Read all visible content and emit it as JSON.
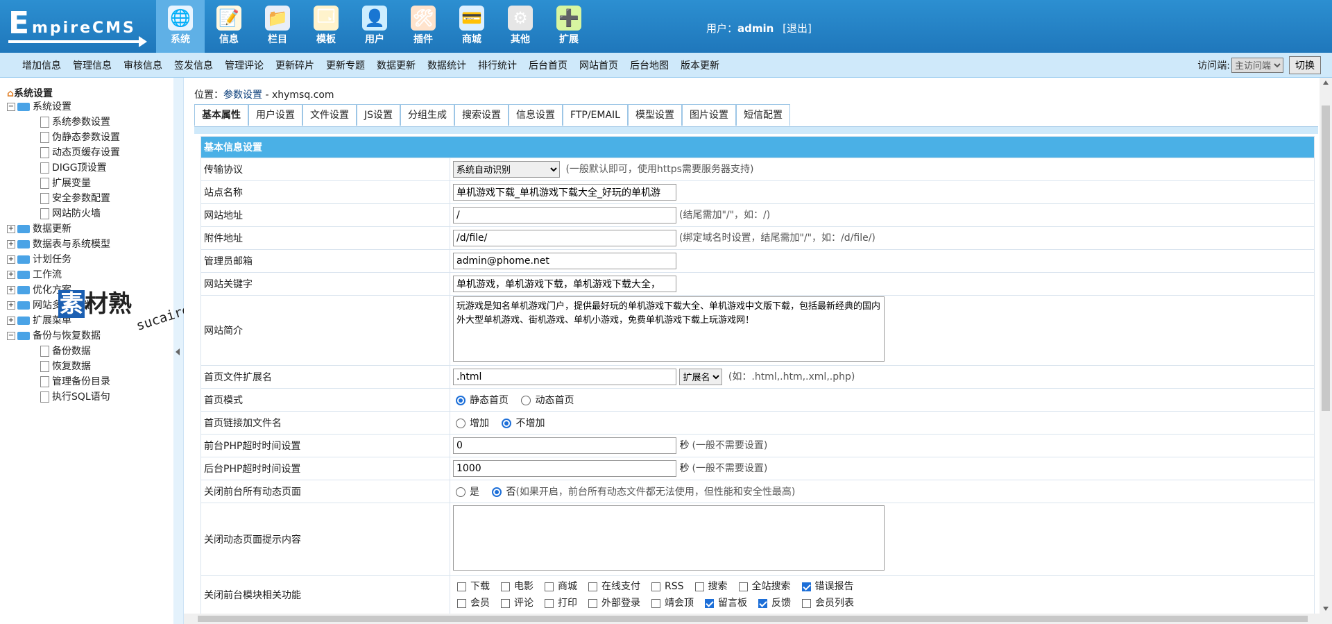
{
  "header": {
    "logo_text": "EmpireCMS",
    "logo_big": "E",
    "logo_rest": "mpireCMS",
    "nav": [
      {
        "label": "系统",
        "icon": "globe-icon",
        "glyph": "🌐",
        "color": "#e8f4ff",
        "active": true
      },
      {
        "label": "信息",
        "icon": "notepad-icon",
        "glyph": "📝",
        "color": "#fff8e0",
        "active": false
      },
      {
        "label": "栏目",
        "icon": "folder-icon",
        "glyph": "📁",
        "color": "#e8eef8",
        "active": false
      },
      {
        "label": "模板",
        "icon": "window-icon",
        "glyph": "🗔",
        "color": "#fff3cc",
        "active": false
      },
      {
        "label": "用户",
        "icon": "user-icon",
        "glyph": "👤",
        "color": "#cdeeff",
        "active": false
      },
      {
        "label": "插件",
        "icon": "tools-icon",
        "glyph": "🛠",
        "color": "#ffe3cc",
        "active": false
      },
      {
        "label": "商城",
        "icon": "card-icon",
        "glyph": "💳",
        "color": "#ddf0ff",
        "active": false
      },
      {
        "label": "其他",
        "icon": "gear-icon",
        "glyph": "⚙",
        "color": "#e6e6e6",
        "active": false
      },
      {
        "label": "扩展",
        "icon": "plus-circle-icon",
        "glyph": "➕",
        "color": "#d7f5a0",
        "active": false
      }
    ],
    "user_label": "用户：",
    "username": "admin",
    "logout": "[退出]"
  },
  "subnav": {
    "items": [
      "增加信息",
      "管理信息",
      "审核信息",
      "签发信息",
      "管理评论",
      "更新碎片",
      "更新专题",
      "数据更新",
      "数据统计",
      "排行统计",
      "后台首页",
      "网站首页",
      "后台地图",
      "版本更新"
    ],
    "visit_label": "访问端:",
    "visit_value": "主访问端",
    "switch_label": "切换"
  },
  "sidebar": {
    "root": "系统设置",
    "rows": [
      {
        "label": "系统设置",
        "type": "folder",
        "toggle": "−",
        "indent": 0
      },
      {
        "label": "系统参数设置",
        "type": "doc",
        "indent": 1
      },
      {
        "label": "伪静态参数设置",
        "type": "doc",
        "indent": 1
      },
      {
        "label": "动态页缓存设置",
        "type": "doc",
        "indent": 1
      },
      {
        "label": "DIGG顶设置",
        "type": "doc",
        "indent": 1
      },
      {
        "label": "扩展变量",
        "type": "doc",
        "indent": 1
      },
      {
        "label": "安全参数配置",
        "type": "doc",
        "indent": 1
      },
      {
        "label": "网站防火墙",
        "type": "doc",
        "indent": 1
      },
      {
        "label": "数据更新",
        "type": "folder",
        "toggle": "+",
        "indent": 0
      },
      {
        "label": "数据表与系统模型",
        "type": "folder",
        "toggle": "+",
        "indent": 0
      },
      {
        "label": "计划任务",
        "type": "folder",
        "toggle": "+",
        "indent": 0
      },
      {
        "label": "工作流",
        "type": "folder",
        "toggle": "+",
        "indent": 0
      },
      {
        "label": "优化方案",
        "type": "folder",
        "toggle": "+",
        "indent": 0
      },
      {
        "label": "网站多访问端",
        "type": "folder",
        "toggle": "+",
        "indent": 0
      },
      {
        "label": "扩展菜单",
        "type": "folder",
        "toggle": "+",
        "indent": 0
      },
      {
        "label": "备份与恢复数据",
        "type": "folder",
        "toggle": "−",
        "indent": 0
      },
      {
        "label": "备份数据",
        "type": "doc",
        "indent": 1
      },
      {
        "label": "恢复数据",
        "type": "doc",
        "indent": 1
      },
      {
        "label": "管理备份目录",
        "type": "doc",
        "indent": 1
      },
      {
        "label": "执行SQL语句",
        "type": "doc",
        "indent": 1
      }
    ]
  },
  "watermark": {
    "brand": "素",
    "brand_rest": "材熟",
    "url": "sucaire.com"
  },
  "content": {
    "breadcrumb_prefix": "位置：",
    "breadcrumb_link": "参数设置",
    "breadcrumb_suffix": " - xhymsq.com",
    "tabs": [
      "基本属性",
      "用户设置",
      "文件设置",
      "JS设置",
      "分组生成",
      "搜索设置",
      "信息设置",
      "FTP/EMAIL",
      "模型设置",
      "图片设置",
      "短信配置"
    ],
    "active_tab": 0,
    "section_title": "基本信息设置",
    "rows": {
      "protocol": {
        "label": "传输协议",
        "value": "系统自动识别",
        "note": "(一般默认即可，使用https需要服务器支持)"
      },
      "sitename": {
        "label": "站点名称",
        "value": "单机游戏下载_单机游戏下载大全_好玩的单机游"
      },
      "siteurl": {
        "label": "网站地址",
        "value": "/",
        "note": "(结尾需加\"/\"，如：/)"
      },
      "fileurl": {
        "label": "附件地址",
        "value": "/d/file/",
        "note": "(绑定域名时设置，结尾需加\"/\"，如：/d/file/)"
      },
      "email": {
        "label": "管理员邮箱",
        "value": "admin@phome.net"
      },
      "keywords": {
        "label": "网站关键字",
        "value": "单机游戏，单机游戏下载，单机游戏下载大全，"
      },
      "intro": {
        "label": "网站简介",
        "value": "玩游戏是知名单机游戏门户，提供最好玩的单机游戏下载大全、单机游戏中文版下载，包括最新经典的国内外大型单机游戏、街机游戏、单机小游戏，免费单机游戏下载上玩游戏网！"
      },
      "indexext": {
        "label": "首页文件扩展名",
        "value": ".html",
        "select": "扩展名",
        "note": "(如：.html,.htm,.xml,.php)"
      },
      "indexmode": {
        "label": "首页模式",
        "opt1": "静态首页",
        "opt2": "动态首页"
      },
      "indexlink": {
        "label": "首页链接加文件名",
        "opt1": "增加",
        "opt2": "不增加"
      },
      "phptimeout": {
        "label": "前台PHP超时时间设置",
        "value": "0",
        "unit": "秒",
        "note": "(一般不需要设置)"
      },
      "adminphptimeout": {
        "label": "后台PHP超时时间设置",
        "value": "1000",
        "unit": "秒",
        "note": "(一般不需要设置)"
      },
      "closedynamic": {
        "label": "关闭前台所有动态页面",
        "opt1": "是",
        "opt2": "否",
        "note": "(如果开启，前台所有动态文件都无法使用，但性能和安全性最高)"
      },
      "closemsg": {
        "label": "关闭动态页面提示内容",
        "value": ""
      },
      "closemodules": {
        "label": "关闭前台模块相关功能",
        "line1": [
          {
            "label": "下载",
            "checked": false
          },
          {
            "label": "电影",
            "checked": false
          },
          {
            "label": "商城",
            "checked": false
          },
          {
            "label": "在线支付",
            "checked": false
          },
          {
            "label": "RSS",
            "checked": false
          },
          {
            "label": "搜索",
            "checked": false
          },
          {
            "label": "全站搜索",
            "checked": false
          },
          {
            "label": "错误报告",
            "checked": true
          }
        ],
        "line2": [
          {
            "label": "会员",
            "checked": false
          },
          {
            "label": "评论",
            "checked": false
          },
          {
            "label": "打印",
            "checked": false
          },
          {
            "label": "外部登录",
            "checked": false
          },
          {
            "label": "靖会顶",
            "checked": false
          },
          {
            "label": "留言板",
            "checked": true
          },
          {
            "label": "反馈",
            "checked": true
          },
          {
            "label": "会员列表",
            "checked": false
          }
        ]
      }
    }
  },
  "colors": {
    "header_bg": "#1f77bb",
    "subnav_bg": "#cfe9fa",
    "section_header": "#4ab0e6",
    "radio_checked": "#1d6fd8"
  }
}
